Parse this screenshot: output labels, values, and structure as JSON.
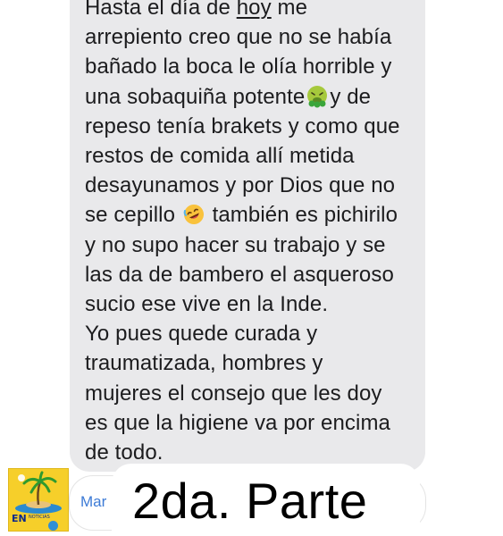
{
  "conversation": {
    "message_lines": [
      {
        "pre": "Hasta el día de ",
        "underlined": "hoy",
        "post": " me"
      },
      {
        "text": "arrepiento creo que no se había"
      },
      {
        "text": "bañado la boca le olía horrible y"
      },
      {
        "pre": "una sobaquiña potente",
        "emoji": "nauseated-face-emoji",
        "post": "y de"
      },
      {
        "text": "repeso tenía brakets y como que"
      },
      {
        "text": "restos de comida allí metida"
      },
      {
        "text": "desayunamos y por Dios que no"
      },
      {
        "pre": "se cepillo ",
        "emoji": "rolling-on-floor-laughing-emoji",
        "post": " también es pichirilo"
      },
      {
        "text": "y no supo hacer su trabajo y se"
      },
      {
        "text": "las da de bambero el asqueroso"
      },
      {
        "text": "sucio ese vive en la Inde."
      },
      {
        "text": "Yo pues quede curada y"
      },
      {
        "text": "traumatizada, hombres y"
      },
      {
        "text": "mujeres el consejo que les doy"
      },
      {
        "text": "es que la higiene va por encima"
      },
      {
        "text": "de todo."
      }
    ]
  },
  "input": {
    "placeholder_visible": "Mar"
  },
  "overlay": {
    "caption": "2da. Parte"
  },
  "logo": {
    "text": "EN",
    "subtext": "NOTICIAS"
  },
  "colors": {
    "bubble": "#e9e9eb",
    "text": "#1c1c1e",
    "link_blue": "#3d7bd6",
    "logo_yellow": "#f6cf2a"
  }
}
